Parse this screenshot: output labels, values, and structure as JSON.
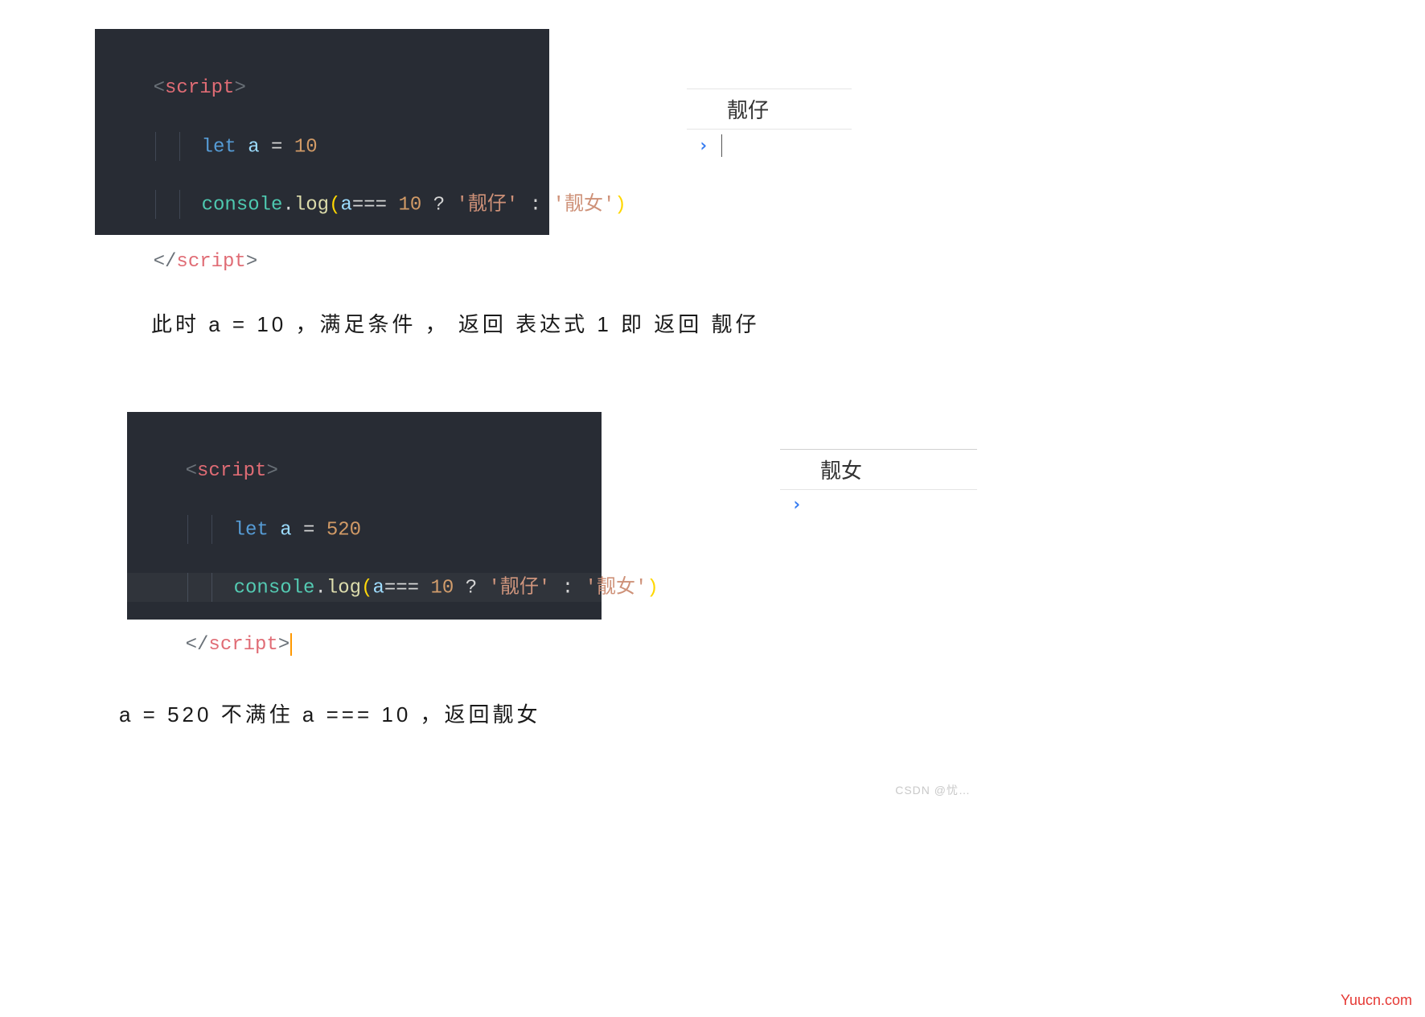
{
  "editor1": {
    "open_tag_lt": "<",
    "open_tag_name": "script",
    "open_tag_gt": ">",
    "let_kw": "let",
    "var_a": " a ",
    "eq": "=",
    "num10": " 10",
    "obj": "console",
    "dot": ".",
    "fn": "log",
    "lparen": "(",
    "expr_a": "a",
    "tripleeq": "=== ",
    "cmp_num": "10",
    "qmark": " ? ",
    "str1": "'靓仔'",
    "colon": " : ",
    "str2": "'靓女'",
    "rparen": ")",
    "close_tag_lt": "</",
    "close_tag_name": "script",
    "close_tag_gt": ">"
  },
  "editor2": {
    "open_tag_lt": "<",
    "open_tag_name": "script",
    "open_tag_gt": ">",
    "let_kw": "let",
    "var_a": " a ",
    "eq": "=",
    "num520": " 520",
    "obj": "console",
    "dot": ".",
    "fn": "log",
    "lparen": "(",
    "expr_a": "a",
    "tripleeq": "=== ",
    "cmp_num": "10",
    "qmark": " ? ",
    "str1": "'靓仔'",
    "colon": " : ",
    "str2": "'靓女'",
    "rparen": ")",
    "close_tag_lt": "</",
    "close_tag_name": "script",
    "close_tag_gt": ">"
  },
  "console1": {
    "output": "靓仔"
  },
  "console2": {
    "output": "靓女"
  },
  "text1": "此时 a = 10 ，满足条件 ， 返回 表达式 1 即 返回 靓仔",
  "text2": "a = 520 不满住 a === 10 ，返回靓女",
  "watermark_csdn": "CSDN @忧…",
  "watermark_yuucn": "Yuucn.com"
}
